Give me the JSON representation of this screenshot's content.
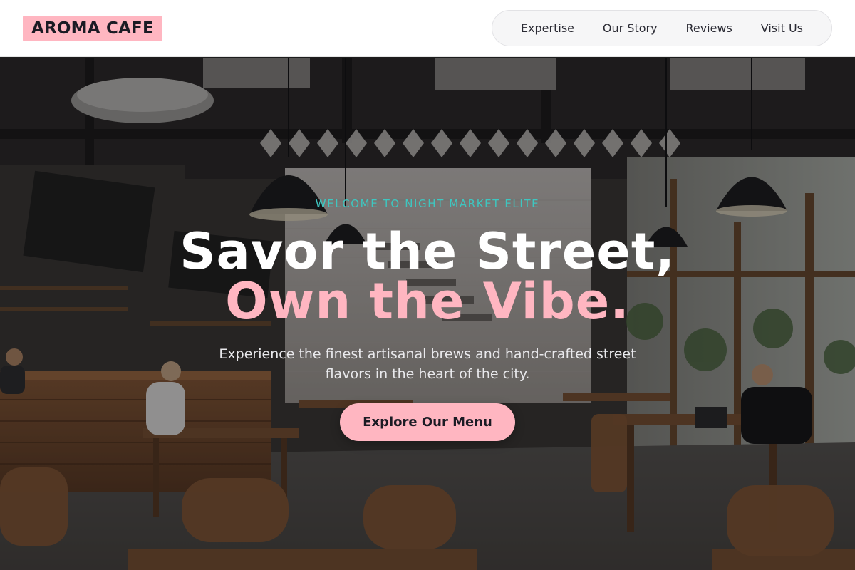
{
  "brand": {
    "name": "AROMA CAFE",
    "accent_color": "#ffb6c1",
    "teal_color": "#3ec6c0"
  },
  "nav": {
    "items": [
      {
        "label": "Expertise"
      },
      {
        "label": "Our Story"
      },
      {
        "label": "Reviews"
      },
      {
        "label": "Visit Us"
      }
    ]
  },
  "hero": {
    "eyebrow": "WELCOME TO NIGHT MARKET ELITE",
    "headline_line1": "Savor the Street,",
    "headline_line2": "Own the Vibe.",
    "subtitle": "Experience the finest artisanal brews and hand-crafted street flavors in the heart of the city.",
    "cta_label": "Explore Our Menu",
    "background_image": "cafe-interior-photo"
  }
}
